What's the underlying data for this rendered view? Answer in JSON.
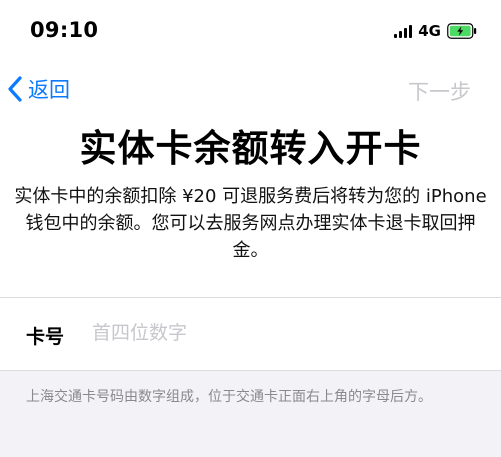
{
  "status_bar": {
    "time": "09:10",
    "network": "4G",
    "icons": [
      "signal-icon",
      "battery-icon"
    ],
    "battery_color": "#4cd964"
  },
  "nav": {
    "back_label": "返回",
    "next_label": "下一步",
    "back_icon": "chevron-left-icon",
    "accent_color": "#0a7aff",
    "disabled_color": "#c8c8cc"
  },
  "title": "实体卡余额转入开卡",
  "description": "实体卡中的余额扣除 ¥20 可退服务费后将转为您的 iPhone 钱包中的余额。您可以去服务网点办理实体卡退卡取回押金。",
  "form": {
    "card_label": "卡号",
    "card_value": "",
    "card_placeholder": "首四位数字"
  },
  "help_text": "上海交通卡号码由数字组成，位于交通卡正面右上角的字母后方。"
}
